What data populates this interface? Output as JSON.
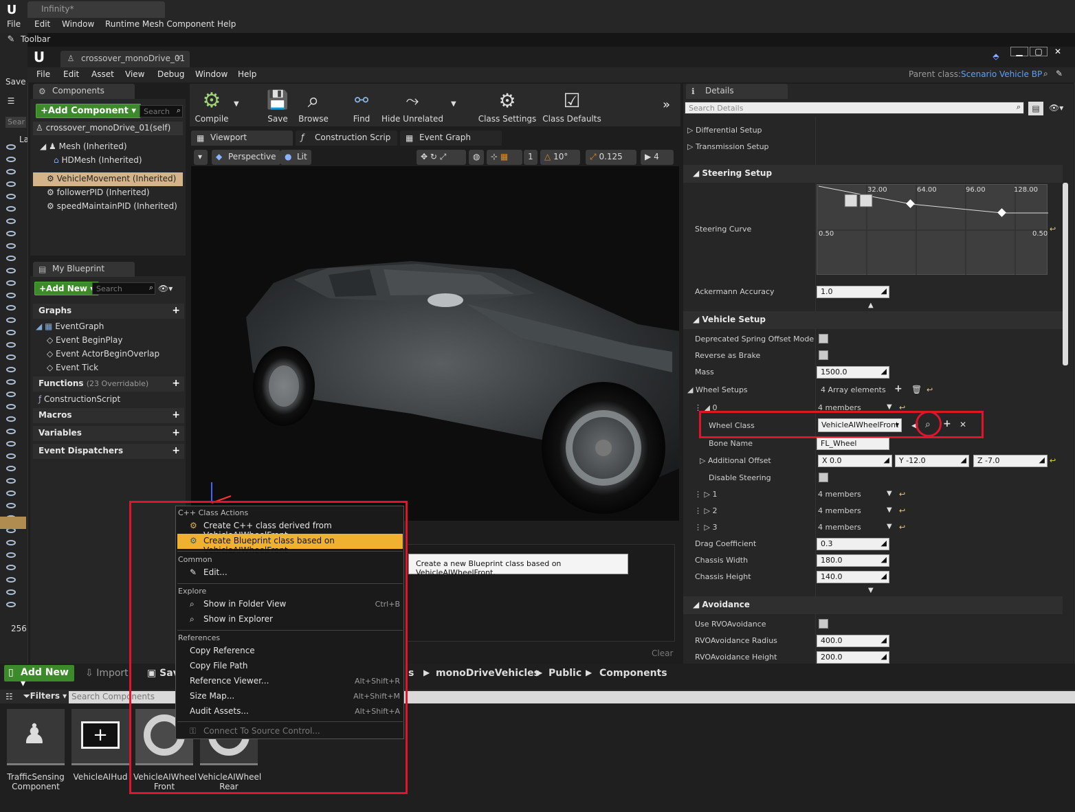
{
  "outer": {
    "tab_title": "Infinity*",
    "menu": [
      "File",
      "Edit",
      "Window",
      "Runtime Mesh Component",
      "Help"
    ],
    "toolbar_title": "Toolbar",
    "save_label": "Save",
    "left_search_partial": "Sear",
    "left_tab_partial": "La",
    "count_label": "256"
  },
  "blueprint": {
    "tab_title": "crossover_monoDrive_01",
    "menu": [
      "File",
      "Edit",
      "Asset",
      "View",
      "Debug",
      "Window",
      "Help"
    ],
    "parent_class_label": "Parent class:",
    "parent_class_value": "Scenario Vehicle BP"
  },
  "components_panel": {
    "tab": "Components",
    "add_button": "+Add Component",
    "search_placeholder": "Search",
    "items": [
      "crossover_monoDrive_01(self)",
      "Mesh (Inherited)",
      "HDMesh (Inherited)",
      "VehicleMovement (Inherited)",
      "followerPID (Inherited)",
      "speedMaintainPID (Inherited)"
    ]
  },
  "my_blueprint": {
    "tab": "My Blueprint",
    "add_button": "+Add New",
    "search_placeholder": "Search",
    "graphs_label": "Graphs",
    "event_graph": "EventGraph",
    "events": [
      "Event BeginPlay",
      "Event ActorBeginOverlap",
      "Event Tick"
    ],
    "functions_label": "Functions",
    "functions_overridable": "(23 Overridable)",
    "construction_script": "ConstructionScript",
    "macros_label": "Macros",
    "variables_label": "Variables",
    "dispatchers_label": "Event Dispatchers"
  },
  "toolbar": {
    "compile": "Compile",
    "save": "Save",
    "browse": "Browse",
    "find": "Find",
    "hide_unrelated": "Hide Unrelated",
    "class_settings": "Class Settings",
    "class_defaults": "Class Defaults"
  },
  "editor_tabs": [
    "Viewport",
    "Construction Scrip",
    "Event Graph"
  ],
  "viewport": {
    "perspective": "Perspective",
    "lit": "Lit",
    "grid_snap": "1",
    "rot_snap": "10°",
    "scale_snap": "0.125",
    "cam_speed": "4"
  },
  "compiler": {
    "clear_label": "Clear",
    "tooltip": "Create a new Blueprint class based on VehicleAIWheelFront."
  },
  "details": {
    "tab": "Details",
    "search_placeholder": "Search Details",
    "differential_setup": "Differential Setup",
    "transmission_setup": "Transmission Setup",
    "steering_setup": "Steering Setup",
    "steering_curve_label": "Steering Curve",
    "curve_x_ticks": [
      "32.00",
      "64.00",
      "96.00",
      "128.00"
    ],
    "curve_y_left": "0.50",
    "curve_y_right": "0.50",
    "ackermann_label": "Ackermann Accuracy",
    "ackermann_value": "1.0",
    "vehicle_setup": "Vehicle Setup",
    "deprecated_spring": "Deprecated Spring Offset Mode",
    "reverse_as_brake": "Reverse as Brake",
    "mass_label": "Mass",
    "mass_value": "1500.0",
    "wheel_setups_label": "Wheel Setups",
    "wheel_setups_value": "4 Array elements",
    "index0": "0",
    "members": "4 members",
    "wheel_class_label": "Wheel Class",
    "wheel_class_value": "VehicleAIWheelFront",
    "bone_name_label": "Bone Name",
    "bone_name_value": "FL_Wheel",
    "additional_offset_label": "Additional Offset",
    "offset_x": "X  0.0",
    "offset_y": "Y  -12.0",
    "offset_z": "Z  -7.0",
    "disable_steering_label": "Disable Steering",
    "index1": "1",
    "index2": "2",
    "index3": "3",
    "drag_label": "Drag Coefficient",
    "drag_value": "0.3",
    "chassis_width_label": "Chassis Width",
    "chassis_width_value": "180.0",
    "chassis_height_label": "Chassis Height",
    "chassis_height_value": "140.0",
    "avoidance": "Avoidance",
    "use_rvo_label": "Use RVOAvoidance",
    "rvo_radius_label": "RVOAvoidance Radius",
    "rvo_radius_value": "400.0",
    "rvo_height_label": "RVOAvoidance Height",
    "rvo_height_value": "200.0"
  },
  "context_menu": {
    "cpp_header": "C++ Class Actions",
    "create_cpp": "Create C++ class derived from VehicleAIWheelFront",
    "create_bp": "Create Blueprint class based on VehicleAIWheelFront",
    "common_header": "Common",
    "edit": "Edit...",
    "explore_header": "Explore",
    "show_folder": "Show in Folder View",
    "show_folder_sc": "Ctrl+B",
    "show_explorer": "Show in Explorer",
    "references_header": "References",
    "copy_ref": "Copy Reference",
    "copy_path": "Copy File Path",
    "ref_viewer": "Reference Viewer...",
    "ref_viewer_sc": "Alt+Shift+R",
    "size_map": "Size Map...",
    "size_map_sc": "Alt+Shift+M",
    "audit": "Audit Assets...",
    "audit_sc": "Alt+Shift+A",
    "connect": "Connect To Source Control..."
  },
  "content_browser": {
    "add_new": "Add New",
    "import": "Import",
    "save": "Sav",
    "path": [
      "s",
      "monoDriveVehicles",
      "Public",
      "Components"
    ],
    "filters": "Filters",
    "search_placeholder": "Search Components",
    "assets": [
      {
        "name": "TrafficSensing Component"
      },
      {
        "name": "VehicleAIHud"
      },
      {
        "name": "VehicleAIWheel Front"
      },
      {
        "name": "VehicleAIWheel Rear"
      }
    ]
  },
  "colors": {
    "accent_green": "#3d8a2a",
    "highlight_red": "#e0152a",
    "selection_orange": "#f0b030",
    "link_blue": "#5aa0ff"
  }
}
